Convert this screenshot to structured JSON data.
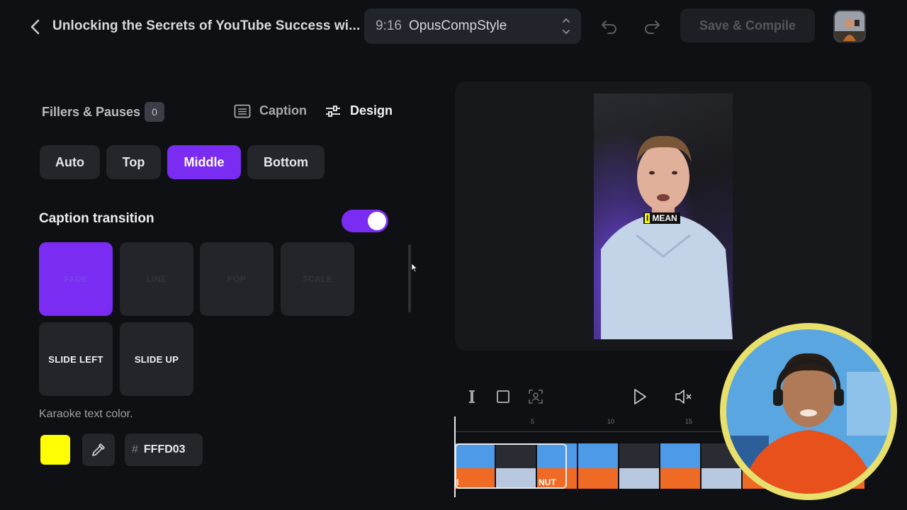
{
  "header": {
    "title": "Unlocking the Secrets of YouTube Success wi...",
    "preset": {
      "ratio": "9:16",
      "name": "OpusCompStyle"
    },
    "save_label": "Save & Compile"
  },
  "left_panel": {
    "fillers_label": "Fillers & Pauses",
    "fillers_count": "0",
    "tabs": [
      {
        "label": "Caption",
        "icon": "caption-list-icon",
        "active": false
      },
      {
        "label": "Design",
        "icon": "sliders-icon",
        "active": true
      }
    ],
    "positions": [
      {
        "label": "Auto",
        "active": false
      },
      {
        "label": "Top",
        "active": false
      },
      {
        "label": "Middle",
        "active": true
      },
      {
        "label": "Bottom",
        "active": false
      }
    ],
    "transition_title": "Caption transition",
    "transition_enabled": true,
    "transitions": [
      {
        "label": "FADE",
        "active": true
      },
      {
        "label": "LINE",
        "active": false
      },
      {
        "label": "POP",
        "active": false
      },
      {
        "label": "SCALE",
        "active": false
      },
      {
        "label": "SLIDE LEFT",
        "active": false
      },
      {
        "label": "SLIDE UP",
        "active": false
      }
    ],
    "karaoke_label": "Karaoke text color.",
    "karaoke_color": "#FFFD03",
    "karaoke_hash": "#",
    "karaoke_hex": "FFFD03"
  },
  "preview": {
    "caption_highlight": "I",
    "caption_word": "MEAN"
  },
  "timeline": {
    "ticks": [
      "5",
      "10",
      "15"
    ],
    "clip_labels": [
      "I",
      "",
      "NUT",
      "",
      "",
      "",
      "",
      "",
      "",
      ""
    ]
  },
  "colors": {
    "accent": "#7B2CF2",
    "karaoke": "#FFFD03",
    "webcam_ring": "#E8E06A"
  }
}
